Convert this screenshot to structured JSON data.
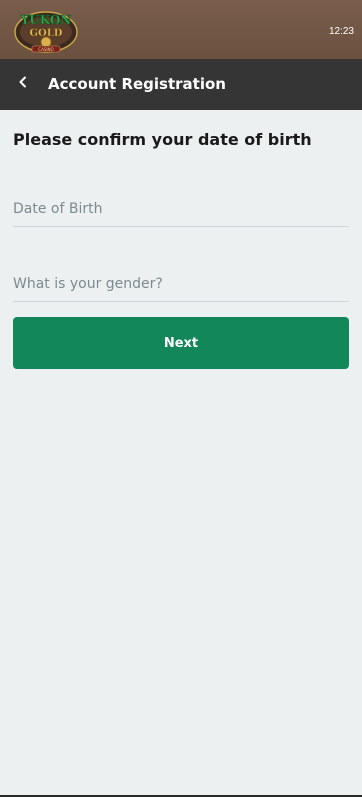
{
  "status_bar": {
    "time": "12:23"
  },
  "brand": {
    "logo_text": "YUKON GOLD CASINO",
    "colors": {
      "top_bar": "#7a5d4b",
      "header": "#353535",
      "accent": "#12875a",
      "background": "#edf0f1"
    }
  },
  "header": {
    "back_icon": "chevron-left-icon",
    "title": "Account Registration"
  },
  "form": {
    "heading": "Please confirm your date of birth",
    "dob": {
      "placeholder": "Date of Birth",
      "value": ""
    },
    "gender": {
      "placeholder": "What is your gender?",
      "value": ""
    },
    "next_label": "Next"
  }
}
